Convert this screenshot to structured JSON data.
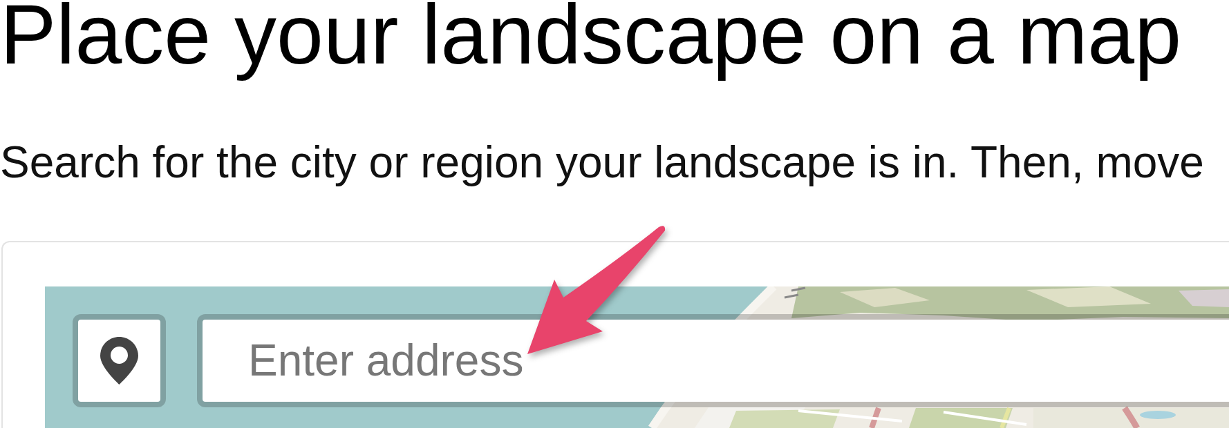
{
  "title": "Place your landscape on a map",
  "instructions": "Search for the city or region your landscape is in. Then, move",
  "map": {
    "address_field": {
      "placeholder": "Enter address"
    }
  }
}
